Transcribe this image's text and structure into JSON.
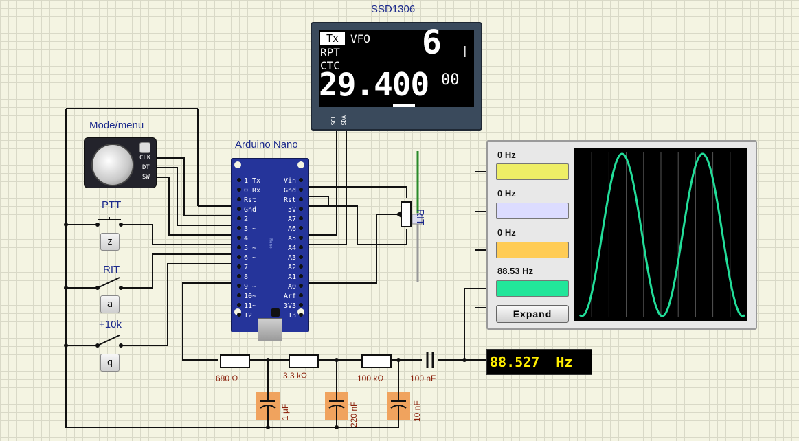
{
  "oled": {
    "title": "SSD1306",
    "tx": "Tx",
    "mode": "VFO",
    "rpt": "RPT",
    "ctc": "CTC",
    "big_digit": "6",
    "freq_main": "29.400",
    "freq_small": "00",
    "pin_scl": "SCL",
    "pin_sda": "SDA"
  },
  "encoder": {
    "title": "Mode/menu",
    "pins": [
      "CLK",
      "DT",
      "SW"
    ]
  },
  "switches": [
    {
      "title": "PTT",
      "key": "z"
    },
    {
      "title": "RIT",
      "key": "a"
    },
    {
      "title": "+10k",
      "key": "q"
    }
  ],
  "arduino": {
    "title": "Arduino Nano",
    "left_pins": [
      "1 Tx",
      "0 Rx",
      "Rst",
      "Gnd",
      "2",
      "3 ~",
      "4",
      "5 ~",
      "6 ~",
      "7",
      "8",
      "9 ~",
      "10~",
      "11~",
      "12"
    ],
    "right_pins": [
      "Vin",
      "Gnd",
      "Rst",
      "5V",
      "A7",
      "A6",
      "A5",
      "A4",
      "A3",
      "A2",
      "A1",
      "A0",
      "Arf",
      "3V3",
      "13"
    ],
    "chip_label": "Nano"
  },
  "pot": {
    "label": "RIT"
  },
  "scope": {
    "channels": [
      {
        "freq": "0 Hz",
        "color": "#eeee66"
      },
      {
        "freq": "0 Hz",
        "color": "#dcdcff"
      },
      {
        "freq": "0 Hz",
        "color": "#ffcc55"
      },
      {
        "freq": "88.53 Hz",
        "color": "#22e69a"
      }
    ],
    "expand_label": "Expand",
    "trace_color": "#22dd99"
  },
  "resistors": [
    "680 Ω",
    "3.3 kΩ",
    "100 kΩ"
  ],
  "capacitor_series": "100 nF",
  "capacitors": [
    "1 µF",
    "220 nF",
    "10 nF"
  ],
  "freq_meter": {
    "value": "88.527  Hz"
  }
}
